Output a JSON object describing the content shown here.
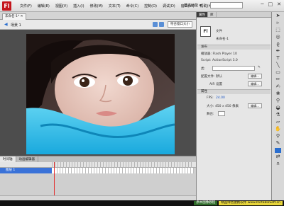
{
  "menubar": {
    "menus": [
      "文件(F)",
      "编辑(E)",
      "视图(V)",
      "插入(I)",
      "修改(M)",
      "文本(T)",
      "命令(C)",
      "控制(O)",
      "调试(D)",
      "窗口(W)",
      "帮助(H)"
    ],
    "workspace": "基本功能 ▾",
    "win_buttons": [
      "─",
      "□",
      "✕"
    ]
  },
  "document": {
    "tab_label": "未命名-1* ✕",
    "scene_label": "场景 1",
    "zoom": "符合窗口大小"
  },
  "timeline": {
    "tabs": [
      "时间轴",
      "动画编辑器"
    ],
    "layer_name": "图层 1"
  },
  "properties": {
    "tabs": [
      "属性",
      "库"
    ],
    "doc_icon": "Fl",
    "doc_type": "文件",
    "doc_name": "未命名-1",
    "publish_header": "发布",
    "player_label": "播放器: Flash Player 10",
    "script_label": "Script: ActionScript 3.0",
    "class_label": "类:",
    "profile_label": "配置文件: 默认",
    "edit_button": "编辑...",
    "air_label": "AIR 设置",
    "props_header": "属性",
    "fps_label": "FPS:",
    "fps_value": "24.00",
    "size_label": "大小: 450 x 450 像素",
    "stage_label": "舞台:"
  },
  "watermarks": [
    "原木图像教程",
    "精品绿色便携软件 www.PortableSoft.cn"
  ],
  "colors": {
    "stage_bg": "#4d4d4d",
    "accent": "#3a72d8",
    "brand": "#c4161c"
  }
}
